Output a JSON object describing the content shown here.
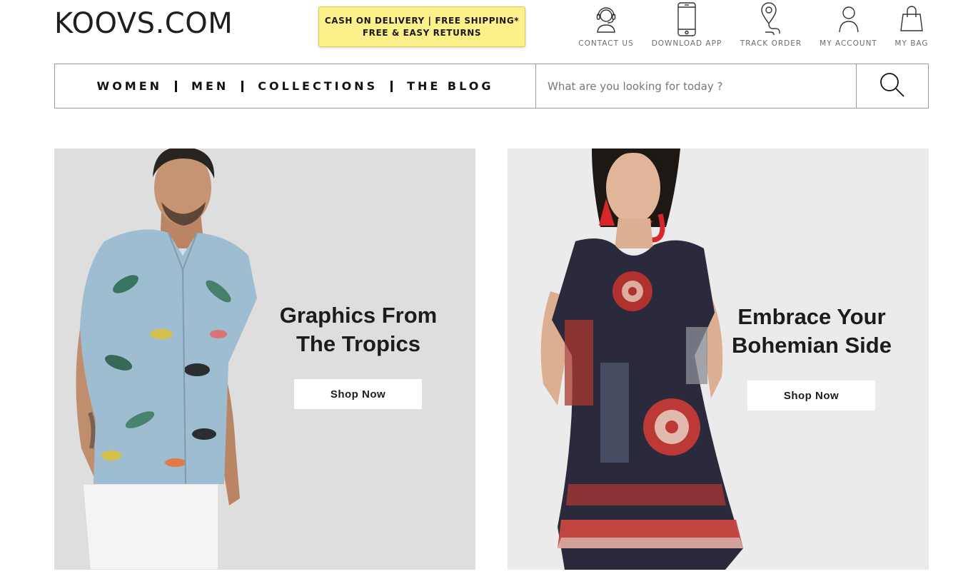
{
  "header": {
    "logo": "KOOVS.COM",
    "promo_line1": "CASH ON DELIVERY | FREE SHIPPING*",
    "promo_line2": "FREE & EASY RETURNS",
    "utilities": [
      {
        "label": "CONTACT US",
        "icon": "headset-icon"
      },
      {
        "label": "DOWNLOAD APP",
        "icon": "smartphone-icon"
      },
      {
        "label": "TRACK ORDER",
        "icon": "location-pin-icon"
      },
      {
        "label": "MY ACCOUNT",
        "icon": "user-icon"
      },
      {
        "label": "MY BAG",
        "icon": "shopping-bag-icon"
      }
    ]
  },
  "nav": {
    "links": [
      "WOMEN",
      "MEN",
      "COLLECTIONS",
      "THE BLOG"
    ]
  },
  "search": {
    "placeholder": "What are you looking for today ?",
    "value": "",
    "icon": "search-icon"
  },
  "banners": [
    {
      "title_line1": "Graphics From",
      "title_line2": "The Tropics",
      "button": "Shop Now"
    },
    {
      "title_line1": "Embrace Your",
      "title_line2": "Bohemian Side",
      "button": "Shop Now"
    }
  ],
  "colors": {
    "promo_bg": "#fbf08a",
    "left_banner_bg": "#dedede",
    "right_banner_bg": "#ebebeb",
    "text_dark": "#1c1c1c"
  }
}
